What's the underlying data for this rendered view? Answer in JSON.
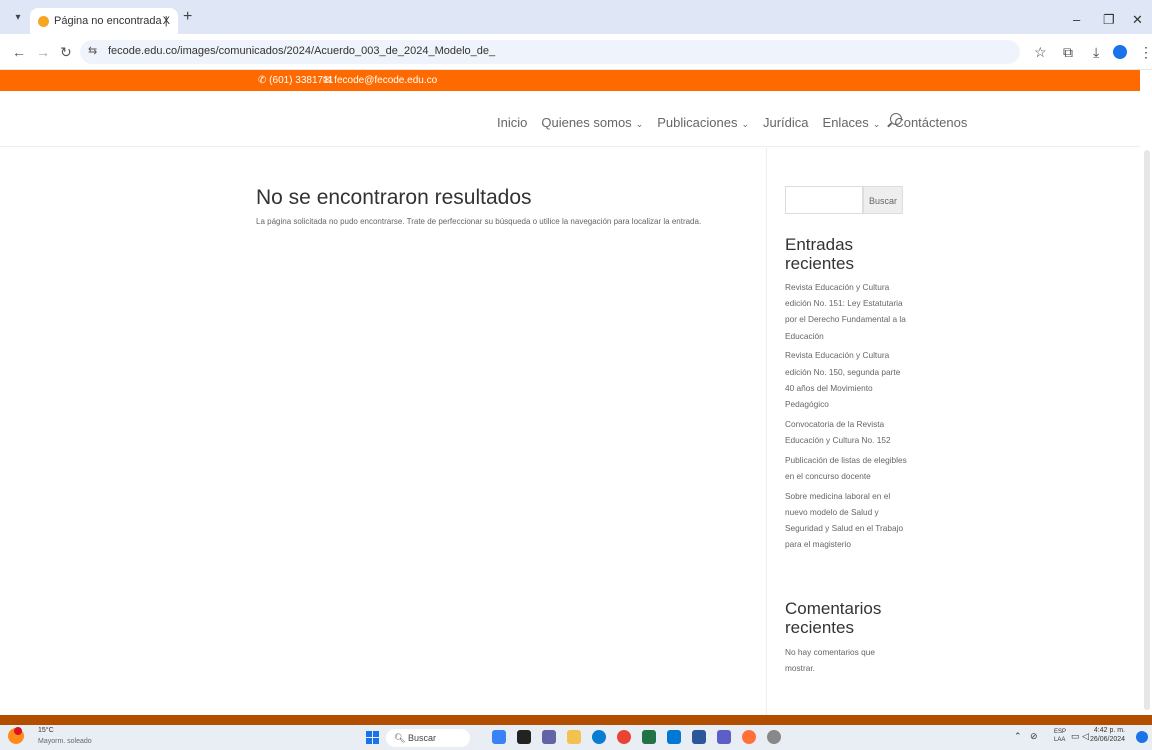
{
  "browser": {
    "tab_title": "Página no encontrada | Fecode",
    "tab_close": "X",
    "new_tab": "+",
    "url": "fecode.edu.co/images/comunicados/2024/Acuerdo_003_de_2024_Modelo_de_"
  },
  "topbar": {
    "phone": "(601) 3381711",
    "email": "fecode@fecode.edu.co",
    "color": "#ff6a00"
  },
  "menu": {
    "items": [
      "Inicio",
      "Quienes somos",
      "Publicaciones",
      "Jurídica",
      "Enlaces",
      "Contáctenos"
    ]
  },
  "main": {
    "title": "No se encontraron resultados",
    "message": "La página solicitada no pudo encontrarse. Trate de perfeccionar su búsqueda o utilice la navegación para localizar la entrada."
  },
  "sidebar": {
    "search_button": "Buscar",
    "recent_posts_heading": "Entradas recientes",
    "recent_posts": [
      "Revista Educación y Cultura edición No. 151: Ley Estatutaria por el Derecho Fundamental a la Educación",
      "Revista Educación y Cultura edición No. 150, segunda parte 40 años del Movimiento Pedagógico",
      "Convocatoria de la Revista Educación y Cultura No. 152",
      "Publicación de listas de elegibles en el concurso docente",
      "Sobre medicina laboral en el nuevo modelo de Salud y Seguridad y Salud en el Trabajo para el magisterio"
    ],
    "recent_comments_heading": "Comentarios recientes",
    "no_comments": "No hay comentarios que mostrar."
  },
  "taskbar": {
    "temperature": "15°C",
    "weather": "Mayorm. soleado",
    "search": "Buscar",
    "lang": "ESP",
    "lang_sub": "LAA",
    "time": "4:42 p. m.",
    "date": "26/06/2024"
  }
}
